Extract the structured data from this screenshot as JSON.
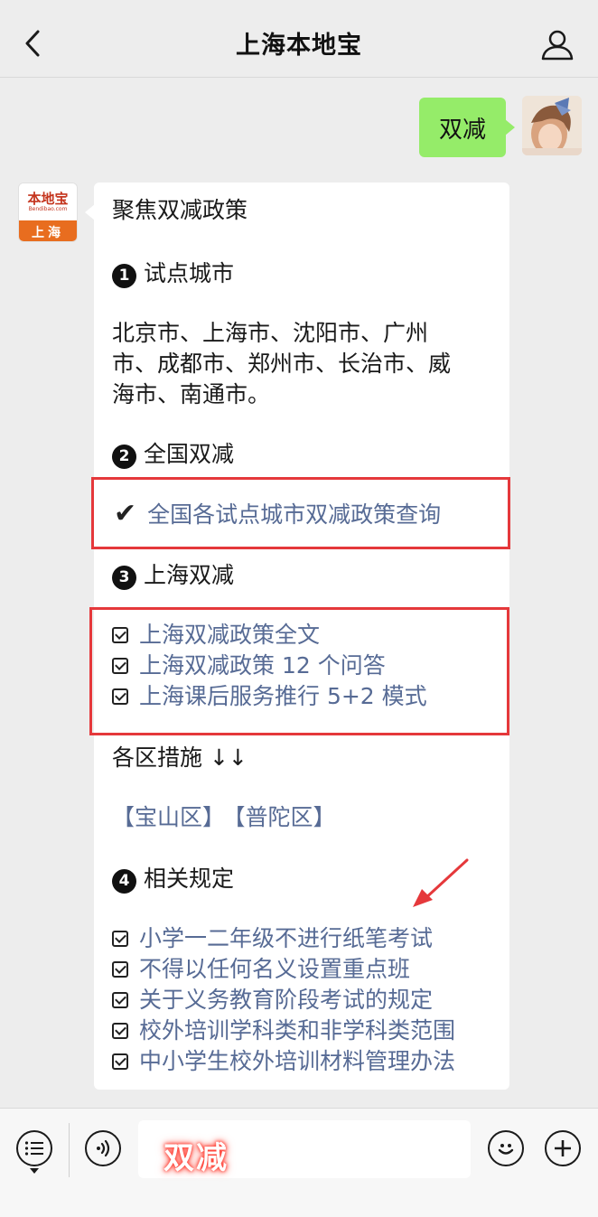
{
  "header": {
    "title": "上海本地宝"
  },
  "outgoing": {
    "text": "双减"
  },
  "bot_logo": {
    "name": "本地宝",
    "url": "Bendibao.com",
    "city": "上海"
  },
  "card": {
    "heading": "聚焦双减政策",
    "sec1": {
      "num": "1",
      "title": "试点城市"
    },
    "cities": [
      "北京市、上海市、沈阳市、广州",
      "市、成都市、郑州市、长治市、威",
      "海市、南通市。"
    ],
    "sec2": {
      "num": "2",
      "title": "全国双减"
    },
    "national_link": {
      "check": "✔",
      "label": "全国各试点城市双减政策查询"
    },
    "sec3": {
      "num": "3",
      "title": "上海双减"
    },
    "shanghai_links": [
      "上海双减政策全文",
      "上海双减政策 12 个问答",
      "上海课后服务推行 5+2 模式"
    ],
    "district_title": "各区措施 ↓↓",
    "districts": [
      "【宝山区】",
      "【普陀区】"
    ],
    "sec4": {
      "num": "4",
      "title": "相关规定"
    },
    "rules": [
      "小学一二年级不进行纸笔考试",
      "不得以任何名义设置重点班",
      "关于义务教育阶段考试的规定",
      "校外培训学科类和非学科类范围",
      "中小学生校外培训材料管理办法"
    ]
  },
  "input": {
    "value": "双减"
  },
  "icons": {
    "back": "chevron-left-icon",
    "user": "user-icon",
    "menu": "list-icon",
    "voice": "voice-icon",
    "emoji": "emoji-icon",
    "plus": "plus-icon"
  },
  "colors": {
    "bubble": "#95ec69",
    "link": "#576b95",
    "highlight": "#e5383b",
    "logo_orange": "#e86d1f"
  }
}
